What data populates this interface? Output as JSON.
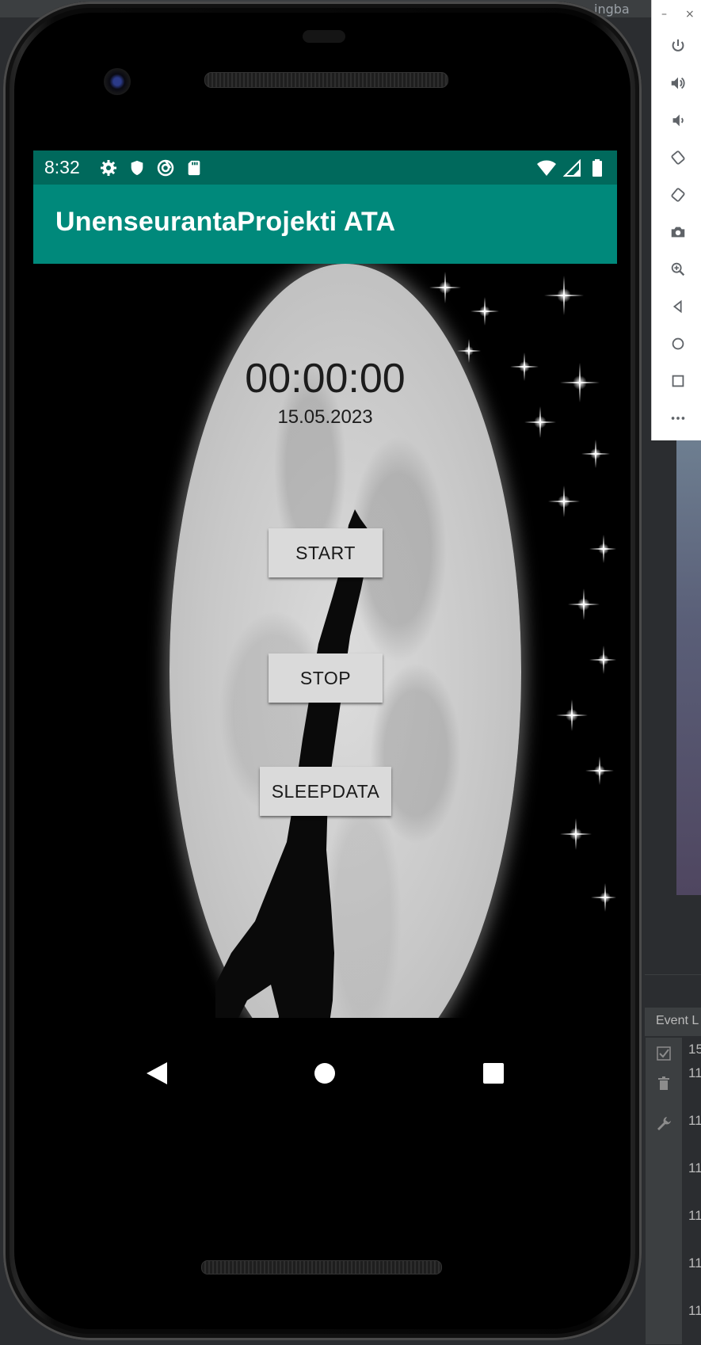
{
  "ide": {
    "top_text": "ingba",
    "event_log_title": "Event L",
    "event_lines": [
      "15",
      "11",
      "11",
      "11",
      "11",
      "11",
      "11"
    ]
  },
  "emulator_panel": {
    "window_controls": [
      "–",
      "×"
    ],
    "buttons": [
      "power-icon",
      "volume-up-icon",
      "volume-down-icon",
      "rotate-left-icon",
      "rotate-right-icon",
      "camera-icon",
      "zoom-icon",
      "back-icon",
      "home-icon",
      "overview-icon",
      "more-icon"
    ]
  },
  "status_bar": {
    "time": "8:32",
    "icons_left": [
      "settings-icon",
      "shield-icon",
      "data-saver-icon",
      "sd-card-icon"
    ],
    "icons_right": [
      "wifi-icon",
      "signal-icon",
      "battery-icon"
    ]
  },
  "app_bar": {
    "title": "UnenseurantaProjekti ATA"
  },
  "main": {
    "timer": "00:00:00",
    "date": "15.05.2023",
    "start_label": "START",
    "stop_label": "STOP",
    "sleepdata_label": "SLEEPDATA"
  },
  "colors": {
    "status_bar": "#00695c",
    "app_bar": "#00897b",
    "button": "#dadada"
  }
}
